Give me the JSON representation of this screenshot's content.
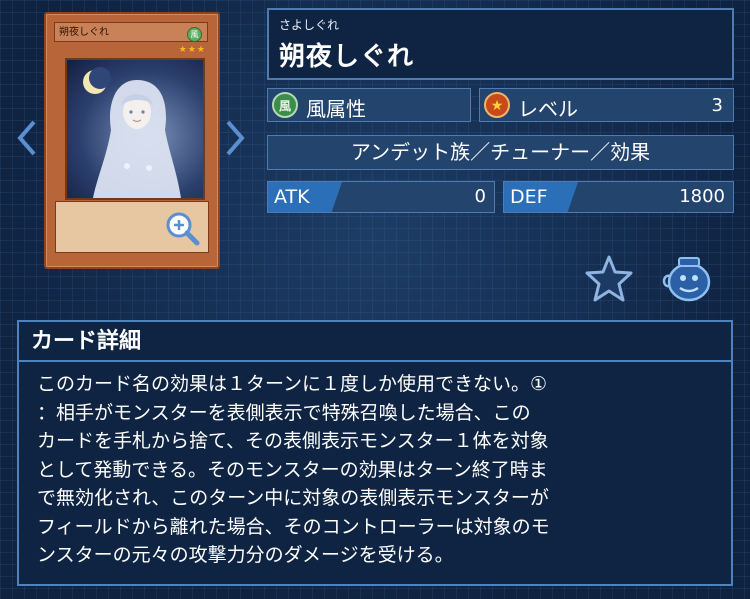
{
  "navigation": {
    "prev_icon": "chevron-left-icon",
    "next_icon": "chevron-right-icon"
  },
  "card_image": {
    "name": "朔夜しぐれ",
    "attribute_glyph": "風",
    "stars": "★★★",
    "zoom_icon": "magnify-plus-icon"
  },
  "card": {
    "reading": "さよしぐれ",
    "name": "朔夜しぐれ",
    "attribute_label": "風属性",
    "attribute_icon_glyph": "風",
    "level_label": "レベル",
    "level_value": "3",
    "type_line": "アンデット族／チューナー／効果",
    "atk_label": "ATK",
    "atk_value": "0",
    "def_label": "DEF",
    "def_value": "1800"
  },
  "actions": {
    "favorite_icon": "star-icon",
    "deck_icon": "deck-pot-icon"
  },
  "detail": {
    "title": "カード詳細",
    "text": "このカード名の効果は１ターンに１度しか使用できない。①\n：相手がモンスターを表側表示で特殊召喚した場合、この\nカードを手札から捨て、その表側表示モンスター１体を対象\nとして発動できる。そのモンスターの効果はターン終了時ま\nで無効化され、このターン中に対象の表側表示モンスターが\nフィールドから離れた場合、そのコントローラーは対象のモ\nンスターの元々の攻撃力分のダメージを受ける。"
  },
  "colors": {
    "background": "#122845",
    "accent": "#2c6fb9",
    "card_frame": "#b8653a"
  }
}
